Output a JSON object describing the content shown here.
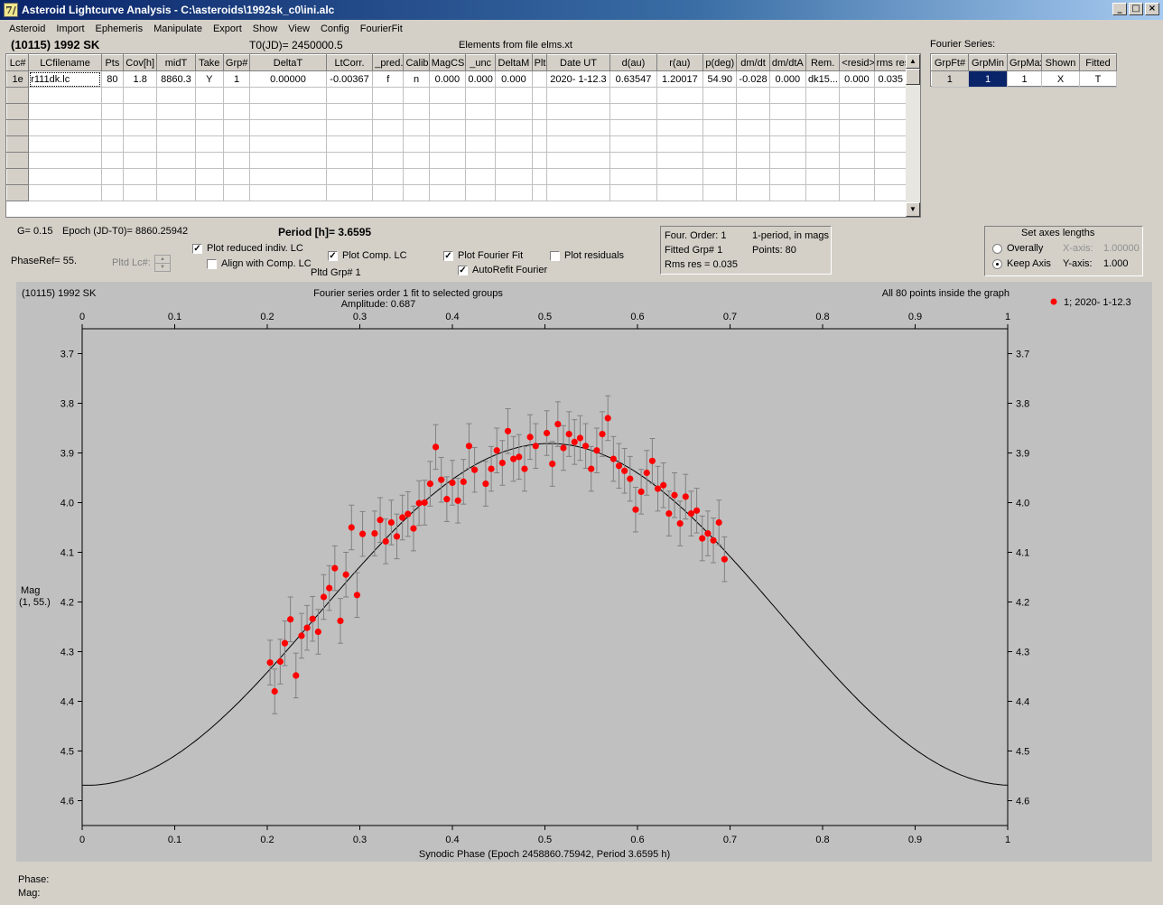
{
  "window": {
    "title": "Asteroid Lightcurve Analysis - C:\\asteroids\\1992sk_c0\\ini.alc",
    "icon": "app-icon",
    "min": "_",
    "max": "□",
    "close": "×"
  },
  "menu": [
    "Asteroid",
    "Import",
    "Ephemeris",
    "Manipulate",
    "Export",
    "Show",
    "View",
    "Config",
    "FourierFit"
  ],
  "header": {
    "asteroid": "(10115) 1992 SK",
    "t0": "T0(JD)= 2450000.5",
    "elements": "Elements from file elms.xt",
    "fourier_title": "Fourier Series:"
  },
  "lc_table": {
    "columns": [
      "Lc#",
      "LCfilename",
      "Pts",
      "Cov[h]",
      "midT",
      "Take",
      "Grp#",
      "DeltaT",
      "LtCorr.",
      "_pred.",
      "Calib.",
      "MagCS",
      "_unc",
      "DeltaM",
      "Plt",
      "Date UT",
      "d(au)",
      "r(au)",
      "p(deg)",
      "dm/dt",
      "dm/dtA",
      "Rem.",
      "<resid>",
      "rms res"
    ],
    "rows": [
      [
        "1e",
        "r111dk.lc",
        "80",
        "1.8",
        "8860.3",
        "Y",
        "1",
        "0.00000",
        "-0.00367",
        "f",
        "n",
        "0.000",
        "0.000",
        "0.000",
        "",
        "2020- 1-12.3",
        "0.63547",
        "1.20017",
        "54.90",
        "-0.028",
        "0.000",
        "dk15...",
        "0.000",
        "0.035"
      ]
    ]
  },
  "fourier_table": {
    "columns": [
      "GrpFt#",
      "GrpMin",
      "GrpMax",
      "Shown",
      "Fitted"
    ],
    "rows": [
      [
        "1",
        "1",
        "1",
        "X",
        "T"
      ]
    ]
  },
  "info": {
    "g": "G= 0.15",
    "epoch": "Epoch (JD-T0)= 8860.25942",
    "period": "Period [h]= 3.6595",
    "phaseref": "PhaseRef= 55.",
    "pltd_lc": "Pltd Lc#:",
    "pltd_grp": "Pltd Grp#  1"
  },
  "checks": {
    "reduced": {
      "label": "Plot reduced indiv. LC",
      "checked": "✓"
    },
    "align": {
      "label": "Align with Comp. LC",
      "checked": ""
    },
    "comp": {
      "label": "Plot Comp. LC",
      "checked": "✓"
    },
    "fourier": {
      "label": "Plot Fourier Fit",
      "checked": "✓"
    },
    "autorefit": {
      "label": "AutoRefit Fourier",
      "checked": "✓"
    },
    "residuals": {
      "label": "Plot residuals",
      "checked": ""
    }
  },
  "fit_box": {
    "order": "Four. Order:  1",
    "period_note": "1-period, in mags",
    "fitted": "Fitted Grp# 1",
    "points": "Points: 80",
    "rms": "Rms res     = 0.035"
  },
  "axes_box": {
    "title": "Set axes lengths",
    "overally": "Overally",
    "keep": "Keep Axis",
    "xlab": "X-axis:",
    "xval": "1.00000",
    "ylab": "Y-axis:",
    "yval": "1.000"
  },
  "status": {
    "phase": "Phase:",
    "mag": "Mag:"
  },
  "chart_data": {
    "type": "scatter",
    "title": "(10115) 1992 SK",
    "subtitle": "Fourier series order 1 fit to selected groups",
    "amplitude": "Amplitude: 0.687",
    "note": "All 80 points inside the graph",
    "xlabel": "Synodic Phase (Epoch 2458860.75942, Period 3.6595 h)",
    "ylabel": "Mag",
    "ylabel2": "(1, 55.)",
    "legend": "1; 2020- 1-12.3",
    "legend_pos": "top-right",
    "xlim": [
      0,
      1
    ],
    "ylim": [
      4.65,
      3.65
    ],
    "xticks": [
      0,
      0.1,
      0.2,
      0.3,
      0.4,
      0.5,
      0.6,
      0.7,
      0.8,
      0.9,
      1
    ],
    "yticks": [
      3.7,
      3.8,
      3.9,
      4.0,
      4.1,
      4.2,
      4.3,
      4.4,
      4.5,
      4.6
    ],
    "fit": {
      "mean": 4.225,
      "amp": 0.344,
      "phase_max": 0.505
    },
    "err": 0.045,
    "colors": {
      "points": "#ff0000",
      "errbars": "#808080",
      "fit": "#000000",
      "bg": "#c0c0c0"
    },
    "points": [
      [
        0.203,
        4.322
      ],
      [
        0.208,
        4.38
      ],
      [
        0.214,
        4.32
      ],
      [
        0.219,
        4.283
      ],
      [
        0.225,
        4.235
      ],
      [
        0.231,
        4.348
      ],
      [
        0.237,
        4.268
      ],
      [
        0.243,
        4.252
      ],
      [
        0.249,
        4.234
      ],
      [
        0.255,
        4.26
      ],
      [
        0.261,
        4.19
      ],
      [
        0.267,
        4.172
      ],
      [
        0.273,
        4.132
      ],
      [
        0.279,
        4.238
      ],
      [
        0.285,
        4.145
      ],
      [
        0.291,
        4.05
      ],
      [
        0.297,
        4.186
      ],
      [
        0.303,
        4.063
      ],
      [
        0.316,
        4.062
      ],
      [
        0.322,
        4.035
      ],
      [
        0.328,
        4.078
      ],
      [
        0.334,
        4.04
      ],
      [
        0.34,
        4.068
      ],
      [
        0.346,
        4.03
      ],
      [
        0.352,
        4.023
      ],
      [
        0.358,
        4.052
      ],
      [
        0.364,
        4.001
      ],
      [
        0.37,
        4.0
      ],
      [
        0.376,
        3.962
      ],
      [
        0.382,
        3.888
      ],
      [
        0.388,
        3.954
      ],
      [
        0.394,
        3.993
      ],
      [
        0.4,
        3.96
      ],
      [
        0.406,
        3.996
      ],
      [
        0.412,
        3.958
      ],
      [
        0.418,
        3.886
      ],
      [
        0.424,
        3.934
      ],
      [
        0.436,
        3.962
      ],
      [
        0.442,
        3.932
      ],
      [
        0.448,
        3.895
      ],
      [
        0.454,
        3.92
      ],
      [
        0.46,
        3.856
      ],
      [
        0.466,
        3.912
      ],
      [
        0.472,
        3.908
      ],
      [
        0.478,
        3.932
      ],
      [
        0.484,
        3.868
      ],
      [
        0.49,
        3.886
      ],
      [
        0.502,
        3.86
      ],
      [
        0.508,
        3.922
      ],
      [
        0.514,
        3.842
      ],
      [
        0.52,
        3.89
      ],
      [
        0.526,
        3.862
      ],
      [
        0.532,
        3.878
      ],
      [
        0.538,
        3.87
      ],
      [
        0.544,
        3.886
      ],
      [
        0.55,
        3.932
      ],
      [
        0.556,
        3.895
      ],
      [
        0.562,
        3.862
      ],
      [
        0.568,
        3.83
      ],
      [
        0.574,
        3.912
      ],
      [
        0.58,
        3.926
      ],
      [
        0.586,
        3.936
      ],
      [
        0.592,
        3.952
      ],
      [
        0.598,
        4.014
      ],
      [
        0.604,
        3.978
      ],
      [
        0.61,
        3.94
      ],
      [
        0.616,
        3.916
      ],
      [
        0.622,
        3.972
      ],
      [
        0.628,
        3.965
      ],
      [
        0.634,
        4.022
      ],
      [
        0.64,
        3.985
      ],
      [
        0.646,
        4.042
      ],
      [
        0.652,
        3.988
      ],
      [
        0.658,
        4.022
      ],
      [
        0.664,
        4.016
      ],
      [
        0.67,
        4.072
      ],
      [
        0.676,
        4.062
      ],
      [
        0.682,
        4.076
      ],
      [
        0.688,
        4.04
      ],
      [
        0.694,
        4.114
      ]
    ]
  }
}
